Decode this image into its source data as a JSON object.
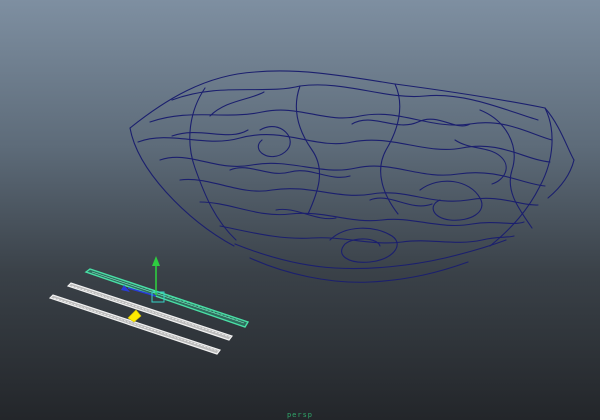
{
  "viewport": {
    "camera_label": "persp",
    "background_top": "#7e8fa1",
    "background_bottom": "#23262a"
  },
  "objects": [
    {
      "name": "curve-nest",
      "kind": "nurbs-curves",
      "color": "#1b1f6e",
      "selected": false
    },
    {
      "name": "curve-strip-1",
      "kind": "curve-ribbon",
      "color": "#49e0a6",
      "selected": true
    },
    {
      "name": "curve-strip-2",
      "kind": "curve-ribbon",
      "color": "#f2f2f2",
      "selected": false
    },
    {
      "name": "curve-strip-3",
      "kind": "curve-ribbon",
      "color": "#f2f2f2",
      "selected": false
    }
  ],
  "manipulator": {
    "type": "move",
    "y_axis_color": "#2ecc40",
    "pivot_color": "#ffeb00"
  },
  "icons": [
    "move-manipulator-icon",
    "pivot-icon"
  ]
}
